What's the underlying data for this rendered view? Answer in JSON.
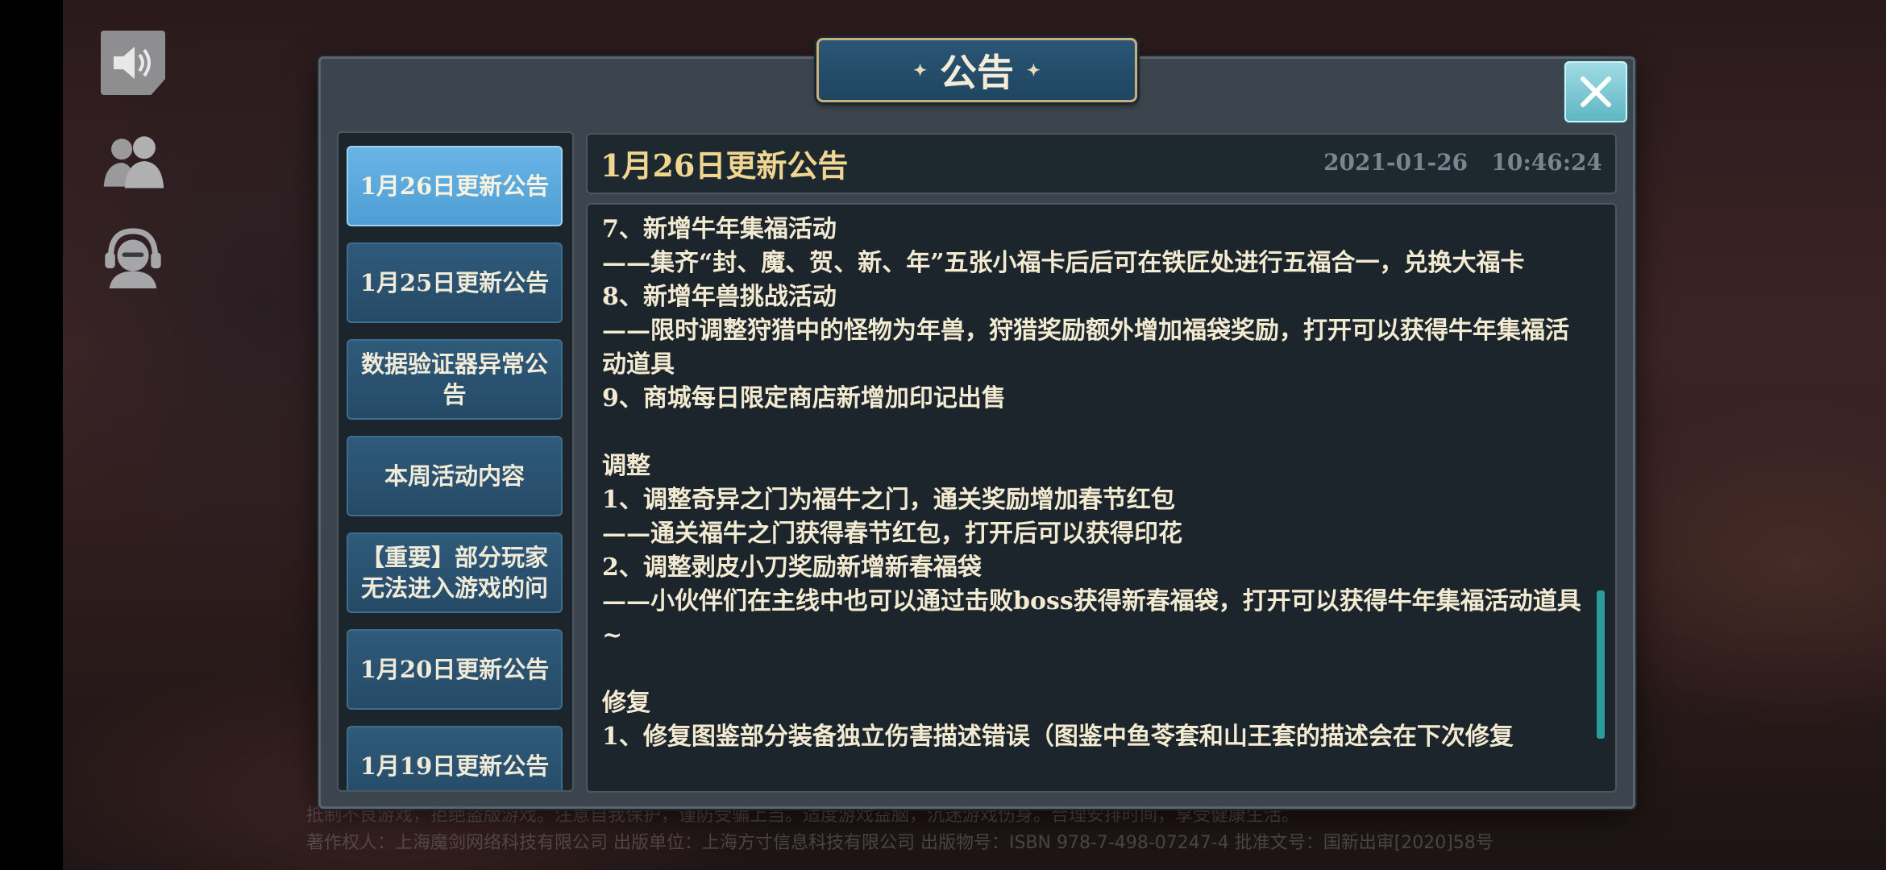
{
  "dialog": {
    "title": "公告",
    "title_decor_left": "✦",
    "title_decor_right": "✦"
  },
  "tabs": [
    {
      "label": "1月26日更新公告",
      "active": true
    },
    {
      "label": "1月25日更新公告",
      "active": false
    },
    {
      "label": "数据验证器异常公告",
      "active": false
    },
    {
      "label": "本周活动内容",
      "active": false
    },
    {
      "label": "【重要】部分玩家无法进入游戏的问",
      "active": false
    },
    {
      "label": "1月20日更新公告",
      "active": false
    },
    {
      "label": "1月19日更新公告",
      "active": false
    }
  ],
  "announcement": {
    "title": "1月26日更新公告",
    "date": "2021-01-26",
    "time": "10:46:24",
    "body": "7、新增牛年集福活动\n——集齐“封、魔、贺、新、年”五张小福卡后后可在铁匠处进行五福合一，兑换大福卡\n8、新增年兽挑战活动\n——限时调整狩猎中的怪物为年兽，狩猎奖励额外增加福袋奖励，打开可以获得牛年集福活动道具\n9、商城每日限定商店新增加印记出售\n\n调整\n1、调整奇异之门为福牛之门，通关奖励增加春节红包\n——通关福牛之门获得春节红包，打开后可以获得印花\n2、调整剥皮小刀奖励新增新春福袋\n——小伙伴们在主线中也可以通过击败boss获得新春福袋，打开可以获得牛年集福活动道具~\n\n修复\n1、修复图鉴部分装备独立伤害描述错误（图鉴中鱼苓套和山王套的描述会在下次修复"
  },
  "footer": {
    "line1": "抵制不良游戏，拒绝盗版游戏。注意自我保护，谨防受骗上当。适度游戏益脑，沉迷游戏伤身。合理安排时间，享受健康生活。",
    "line2": "著作权人：上海魔剑网络科技有限公司    出版单位：上海方寸信息科技有限公司    出版物号：ISBN 978-7-498-07247-4    批准文号：国新出审[2020]58号"
  },
  "colors": {
    "accent": "#4e9ed4",
    "header_title": "#f0d690",
    "close_button": "#7fc9d4",
    "scrollbar": "#2b9a9c"
  },
  "icons": {
    "speaker": "speaker-icon",
    "friends": "friends-icon",
    "support": "headset-icon",
    "close": "close-icon"
  }
}
